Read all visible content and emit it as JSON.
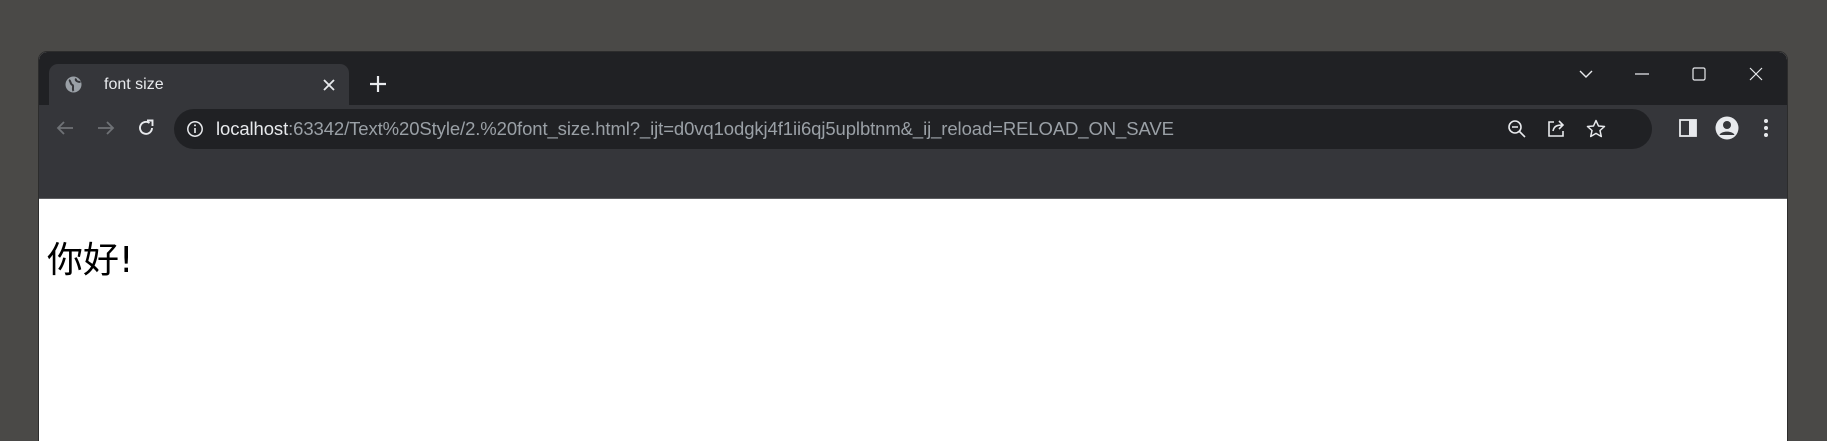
{
  "tab": {
    "title": "font size",
    "favicon": "globe-icon",
    "close_icon": "close-icon"
  },
  "new_tab_icon": "plus-icon",
  "window_controls": [
    "tab-search-icon",
    "minimize-icon",
    "maximize-icon",
    "close-icon"
  ],
  "nav": [
    "back-arrow-icon",
    "forward-arrow-icon",
    "reload-icon"
  ],
  "omnibox": {
    "info_icon": "info-icon",
    "url_host": "localhost",
    "url_rest": ":63342/Text%20Style/2.%20font_size.html?_ijt=d0vq1odgkj4f1ii6qj5uplbtnm&_ij_reload=RELOAD_ON_SAVE",
    "actions": [
      "zoom-out-icon",
      "share-icon",
      "bookmark-star-icon"
    ]
  },
  "toolbar_actions": [
    "side-panel-icon",
    "profile-icon",
    "menu-icon"
  ],
  "page": {
    "heading": "你好!"
  },
  "colors": {
    "frame": "#202124",
    "toolbar": "#35363a",
    "text": "#e8eaed",
    "muted": "#9aa0a6"
  }
}
